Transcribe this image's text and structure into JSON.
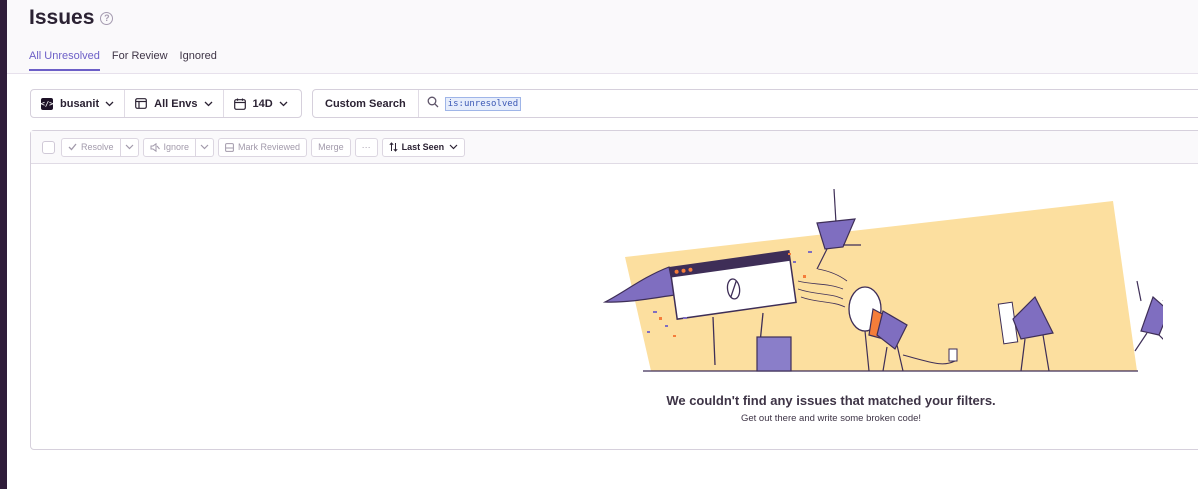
{
  "header": {
    "title": "Issues",
    "help_icon": "question-circle-icon",
    "tabs": [
      {
        "label": "All Unresolved",
        "active": true
      },
      {
        "label": "For Review",
        "active": false
      },
      {
        "label": "Ignored",
        "active": false
      }
    ]
  },
  "filters": {
    "project": "busanit",
    "environment": "All Envs",
    "period": "14D"
  },
  "search": {
    "custom_search_label": "Custom Search",
    "query": "is:unresolved"
  },
  "toolbar": {
    "resolve": "Resolve",
    "ignore": "Ignore",
    "mark_reviewed": "Mark Reviewed",
    "merge": "Merge",
    "more": "···",
    "sort": "Last Seen"
  },
  "empty_state": {
    "title": "We couldn't find any issues that matched your filters.",
    "subtitle": "Get out there and write some broken code!"
  },
  "colors": {
    "accent": "#6c5fc7",
    "illustration_bg": "#fcdf9f",
    "illustration_purple": "#7f6ec0",
    "illustration_orange": "#f57d3a"
  }
}
